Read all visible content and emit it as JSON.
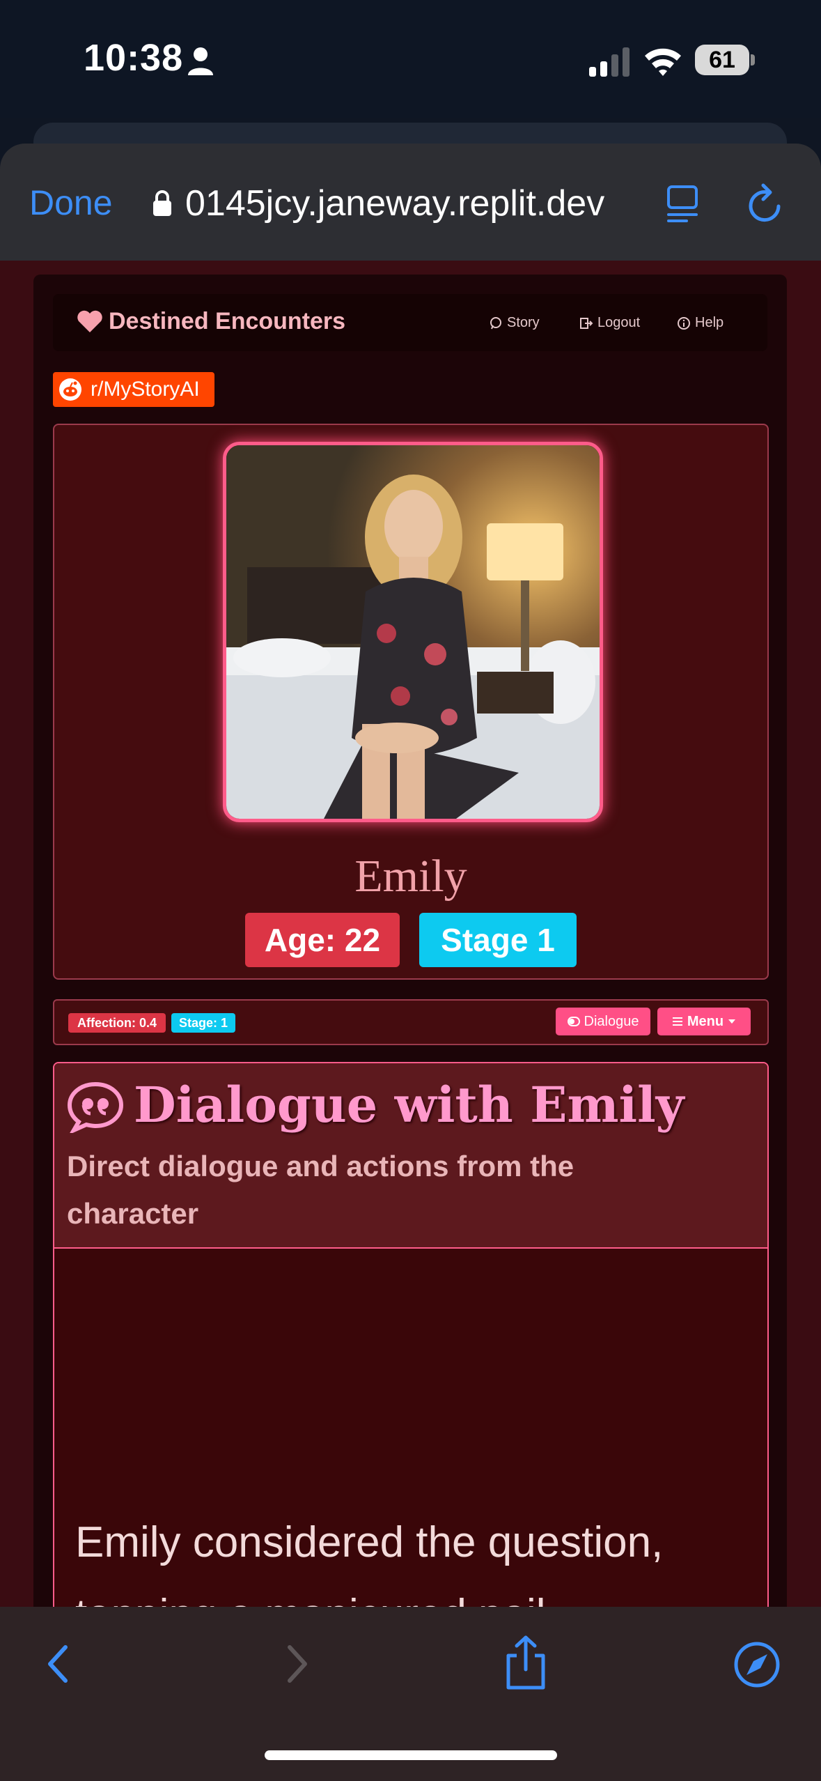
{
  "status_bar": {
    "time": "10:38",
    "battery": "61"
  },
  "browser": {
    "done_label": "Done",
    "url": "0145jcy.janeway.replit.dev"
  },
  "navbar": {
    "brand": "Destined Encounters",
    "links": [
      {
        "label": "Story"
      },
      {
        "label": "Logout"
      },
      {
        "label": "Help"
      }
    ]
  },
  "reddit": {
    "label": "r/MyStoryAI"
  },
  "profile": {
    "name": "Emily",
    "age_badge": "Age: 22",
    "stage_badge": "Stage 1"
  },
  "toolbar": {
    "affection": "Affection: 0.4",
    "stage": "Stage: 1",
    "dialogue_button": "Dialogue",
    "menu_button": "Menu"
  },
  "dialogue": {
    "title": "Dialogue with Emily",
    "subtitle": "Direct dialogue and actions from the character",
    "text": "Emily considered the question, tapping a manicured nail"
  },
  "colors": {
    "accent_pink": "#ff5c8a",
    "danger": "#dc3545",
    "info": "#0dcaf0",
    "link_blue": "#3d8ef7",
    "reddit": "#ff4500"
  }
}
